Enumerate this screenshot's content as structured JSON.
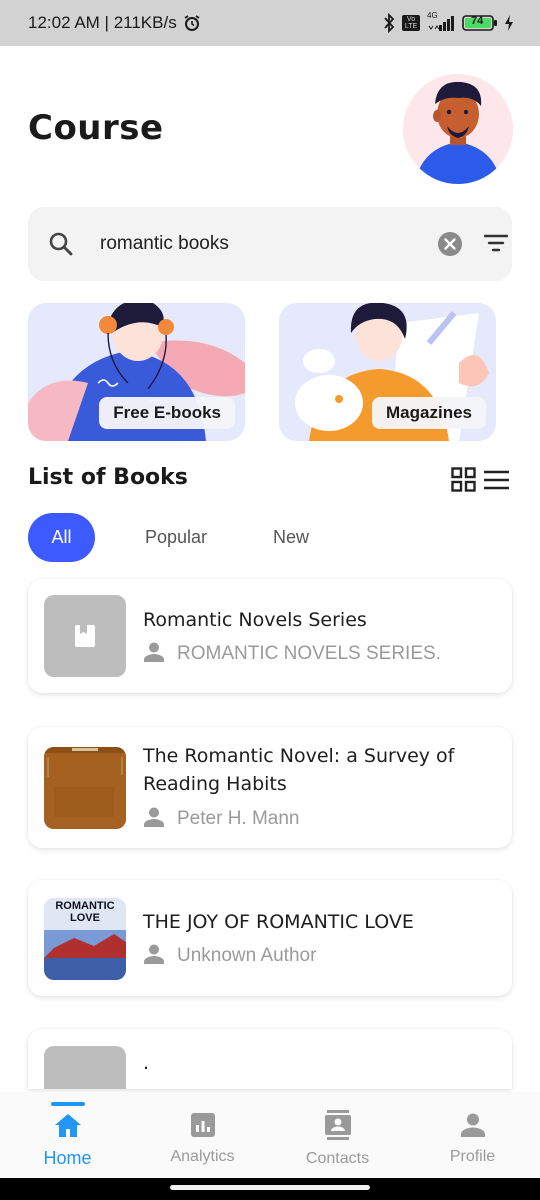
{
  "status_bar": {
    "time_speed": "12:02 AM | 211KB/s",
    "network_badge": "Vo LTE",
    "network_type": "4G",
    "battery": "74"
  },
  "header": {
    "title": "Course"
  },
  "search": {
    "value": "romantic books",
    "placeholder": "Search"
  },
  "categories": [
    {
      "label": "Free E-books"
    },
    {
      "label": "Magazines"
    }
  ],
  "section": {
    "title": "List of Books"
  },
  "filters": {
    "chips": [
      "All",
      "Popular",
      "New"
    ],
    "selected": "All"
  },
  "books": [
    {
      "title": "Romantic Novels Series",
      "author": "ROMANTIC NOVELS SERIES."
    },
    {
      "title": "The Romantic Novel: a Survey of Reading Habits",
      "author": "Peter H. Mann"
    },
    {
      "title": "THE JOY OF ROMANTIC LOVE",
      "author": "Unknown Author",
      "cover_text": "ROMANTIC LOVE"
    },
    {
      "title": "."
    }
  ],
  "bottom_nav": {
    "items": [
      {
        "label": "Home",
        "icon": "home-icon",
        "active": true
      },
      {
        "label": "Analytics",
        "icon": "analytics-icon",
        "active": false
      },
      {
        "label": "Contacts",
        "icon": "contacts-icon",
        "active": false
      },
      {
        "label": "Profile",
        "icon": "profile-icon",
        "active": false
      }
    ]
  },
  "colors": {
    "accent": "#3d5afe",
    "nav_active": "#2196f3",
    "muted_text": "#9a9a9a"
  }
}
